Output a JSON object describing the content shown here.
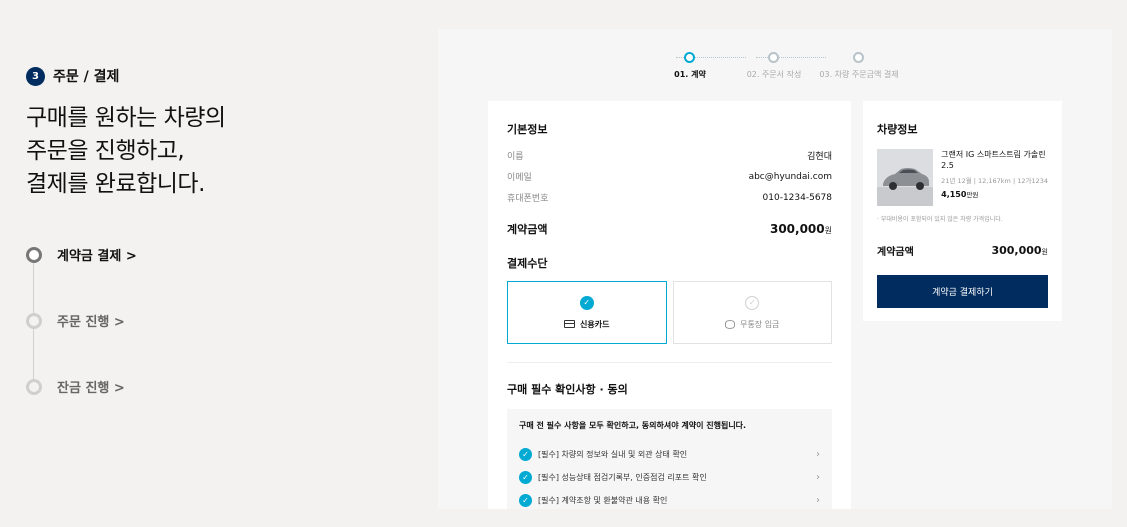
{
  "left": {
    "step_number": "3",
    "step_title": "주문 / 결제",
    "headline": [
      "구매를 원하는 차량의",
      "주문을 진행하고,",
      "결제를 완료합니다."
    ],
    "steps": [
      {
        "label": "계약금 결제 >",
        "active": true
      },
      {
        "label": "주문 진행 >",
        "active": false
      },
      {
        "label": "잔금 진행 >",
        "active": false
      }
    ]
  },
  "progress": {
    "steps": [
      "01. 계약",
      "02. 주문서 작성",
      "03. 차량 주문금액 결제"
    ],
    "current": 0
  },
  "basic_info": {
    "title": "기본정보",
    "rows": [
      {
        "label": "이름",
        "value": "김현대"
      },
      {
        "label": "이메일",
        "value": "abc@hyundai.com"
      },
      {
        "label": "휴대폰번호",
        "value": "010-1234-5678"
      }
    ]
  },
  "contract": {
    "label": "계약금액",
    "amount": "300,000",
    "unit": "원"
  },
  "payment": {
    "title": "결제수단",
    "options": [
      {
        "label": "신용카드",
        "selected": true
      },
      {
        "label": "무통장 입금",
        "selected": false
      }
    ]
  },
  "agreement": {
    "title": "구매 필수 확인사항 · 동의",
    "notice": "구매 전 필수 사항을 모두 확인하고, 동의하셔야 계약이 진행됩니다.",
    "items": [
      "[필수] 차량의 정보와 실내 및 외관 상태 확인",
      "[필수] 성능상태 점검기록부, 인증점검 리포트 확인",
      "[필수] 계약조항 및 환불약관 내용 확인"
    ]
  },
  "vehicle": {
    "title": "차량정보",
    "name": "그랜저 IG 스마트스트림 가솔린 2.5",
    "meta": [
      "21년 12월",
      "12,167km",
      "12가1234"
    ],
    "price": "4,150",
    "price_unit": "만원",
    "note": "· 부대비용이 포함되어 있지 않은 차량 가격입니다.",
    "amount_label": "계약금액",
    "amount": "300,000",
    "amount_unit": "원",
    "button": "계약금 결제하기"
  },
  "colors": {
    "navy": "#002c5f",
    "accent": "#00aad2"
  }
}
